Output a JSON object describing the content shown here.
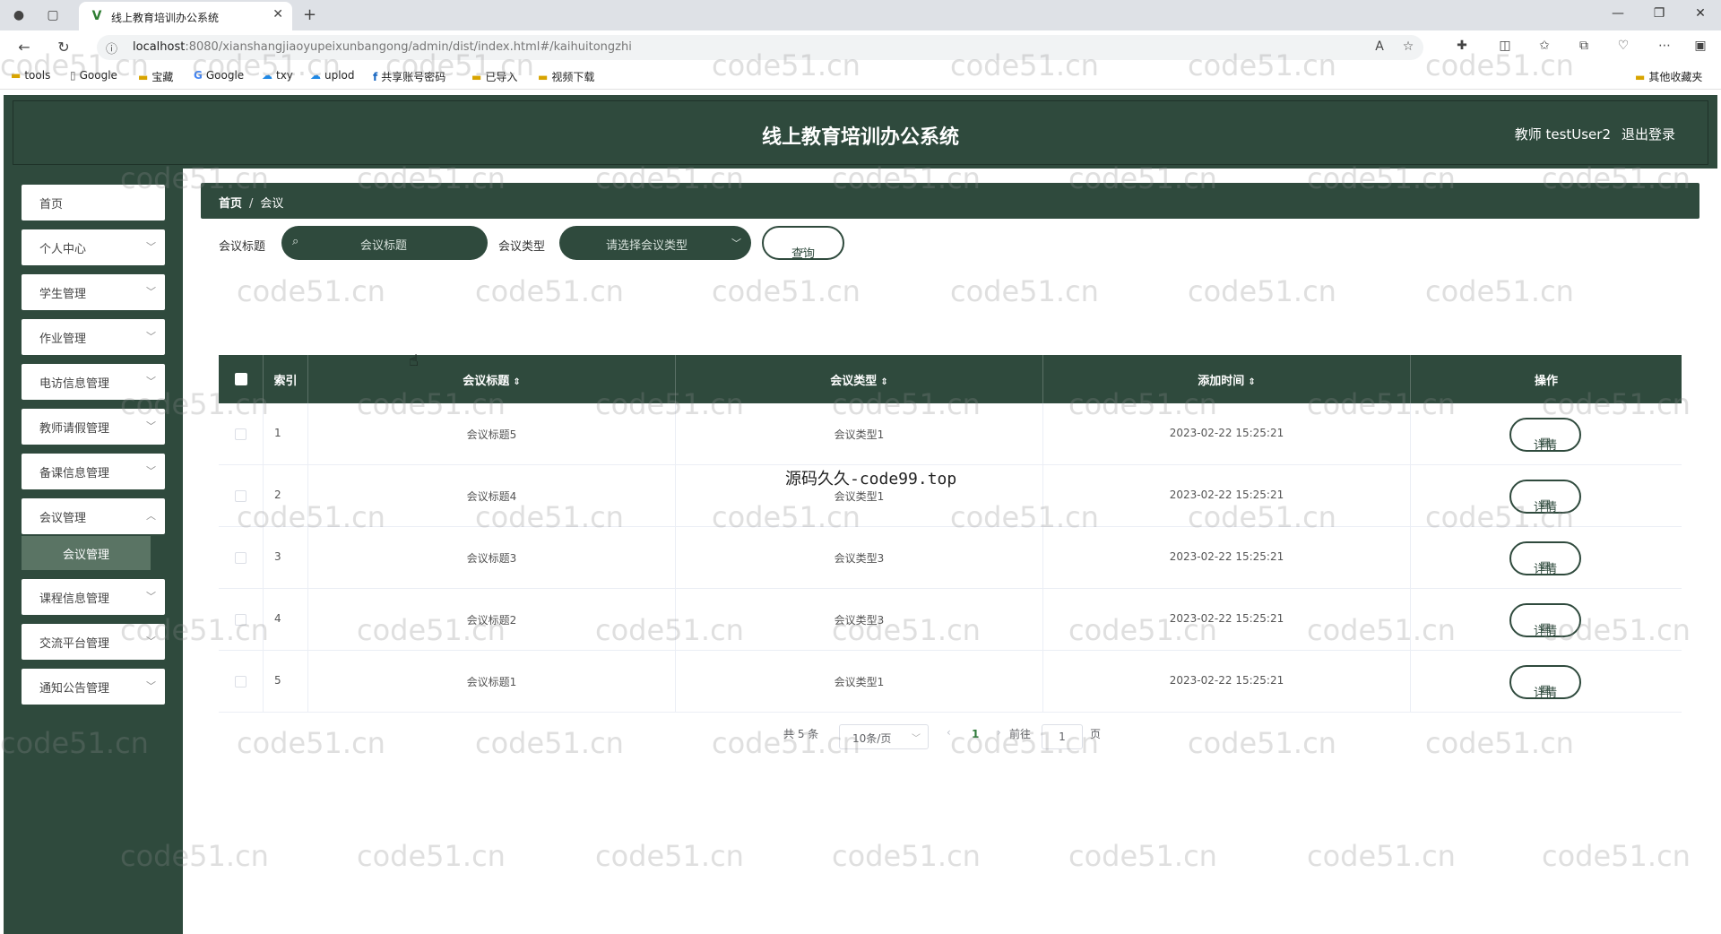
{
  "browser": {
    "tab_title": "线上教育培训办公系统",
    "url_host": "localhost",
    "url_rest": ":8080/xianshangjiaoyupeixunbangong/admin/dist/index.html#/kaihuitongzhi",
    "bookmarks": [
      "tools",
      "Google",
      "宝藏",
      "Google",
      "txy",
      "uplod",
      "共享账号密码",
      "已导入",
      "视频下载"
    ],
    "other_bookmarks": "其他收藏夹"
  },
  "header": {
    "title": "线上教育培训办公系统",
    "user": "教师 testUser2",
    "logout": "退出登录"
  },
  "sidebar": {
    "items": [
      {
        "label": "首页",
        "has_arrow": false
      },
      {
        "label": "个人中心",
        "has_arrow": true
      },
      {
        "label": "学生管理",
        "has_arrow": true
      },
      {
        "label": "作业管理",
        "has_arrow": true
      },
      {
        "label": "电访信息管理",
        "has_arrow": true
      },
      {
        "label": "教师请假管理",
        "has_arrow": true
      },
      {
        "label": "备课信息管理",
        "has_arrow": true
      },
      {
        "label": "会议管理",
        "has_arrow": true
      },
      {
        "label": "课程信息管理",
        "has_arrow": true
      },
      {
        "label": "交流平台管理",
        "has_arrow": true
      },
      {
        "label": "通知公告管理",
        "has_arrow": true
      }
    ],
    "active_sub": "会议管理"
  },
  "breadcrumb": {
    "home": "首页",
    "sep": "/",
    "current": "会议"
  },
  "search": {
    "title_label": "会议标题",
    "title_placeholder": "会议标题",
    "type_label": "会议类型",
    "type_placeholder": "请选择会议类型",
    "query_button": "查询"
  },
  "table": {
    "headers": {
      "index": "索引",
      "title": "会议标题",
      "type": "会议类型",
      "time": "添加时间",
      "action": "操作"
    },
    "detail_label": "详情",
    "rows": [
      {
        "index": "1",
        "title": "会议标题5",
        "type": "会议类型1",
        "time": "2023-02-22 15:25:21"
      },
      {
        "index": "2",
        "title": "会议标题4",
        "type": "会议类型1",
        "time": "2023-02-22 15:25:21"
      },
      {
        "index": "3",
        "title": "会议标题3",
        "type": "会议类型3",
        "time": "2023-02-22 15:25:21"
      },
      {
        "index": "4",
        "title": "会议标题2",
        "type": "会议类型3",
        "time": "2023-02-22 15:25:21"
      },
      {
        "index": "5",
        "title": "会议标题1",
        "type": "会议类型1",
        "time": "2023-02-22 15:25:21"
      }
    ]
  },
  "pagination": {
    "total": "共 5 条",
    "page_size": "10条/页",
    "prev": "‹",
    "current": "1",
    "next": "›",
    "goto_label": "前往",
    "goto_value": "1",
    "page_unit": "页"
  },
  "watermark": {
    "text": "code51.cn",
    "center_text": "源码久久-code99.top"
  },
  "colors": {
    "primary": "#2f4a3d",
    "submenu": "#5a7464",
    "accent_page": "#2f7a3a"
  }
}
